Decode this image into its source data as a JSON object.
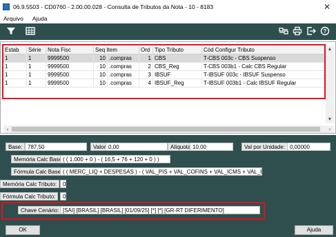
{
  "window": {
    "title": "06.9.5503 - CD0760 - 2.00.00.028 - Consulta de Tributos da Nota - 10 - 8183",
    "close": "✕"
  },
  "menu": {
    "items": [
      "Arquivo",
      "Ajuda"
    ]
  },
  "toolbar": {
    "filter_icon": "filter-icon",
    "table_icon": "table-icon",
    "right_icons": [
      "settings-icon",
      "print-icon",
      "exit-icon",
      "help-icon"
    ]
  },
  "grid": {
    "columns": [
      "Estab",
      "Série",
      "Nota Fisc",
      "Seq Item",
      "Ord",
      "Tipo Tributo",
      "Cód Configur Tributo"
    ],
    "rows": [
      {
        "estab": "1",
        "serie": "1",
        "nota": "9999500",
        "seq": "10",
        "item": ".compras",
        "ord": "1",
        "tipo": "CBS",
        "cod": "T-CBS 003c - CBS Suspenso"
      },
      {
        "estab": "1",
        "serie": "1",
        "nota": "9999500",
        "seq": "10",
        "item": ".compras",
        "ord": "2",
        "tipo": "CBS_Reg",
        "cod": "T-CBS 003b1 - Calc CBS Regular"
      },
      {
        "estab": "1",
        "serie": "1",
        "nota": "9999500",
        "seq": "10",
        "item": ".compras",
        "ord": "3",
        "tipo": "IBSUF",
        "cod": "T-IBSUF 003c - IBSUF Suspenso"
      },
      {
        "estab": "1",
        "serie": "1",
        "nota": "9999500",
        "seq": "10",
        "item": ".compras",
        "ord": "4",
        "tipo": "IBSUF_Reg",
        "cod": "T-IBSUF 003b1 - Calc IBSUF Regular"
      }
    ]
  },
  "details": {
    "base_label": "Base:",
    "base_value": "787,50",
    "valor_label": "Valor:",
    "valor_value": "0,00",
    "aliquota_label": "Alíquota:",
    "aliquota_value": "10,00",
    "valor_unidade_label": "Val por Unidade:",
    "valor_unidade_value": "0,00000",
    "memoria_base_label": "Memória Calc Base:",
    "memoria_base_value": "( ( 1.000 + 0 ) - ( 16,5 + 76 + 120 + 0 ) )",
    "formula_base_label": "Fórmula Calc Base:",
    "formula_base_value": "( ( MERC_LIQ + DESPESAS ) - ( VAL_PIS + VAL_COFINS + VAL_ICMS + VAL_ISS ) )",
    "memoria_tributo_label": "Memória Calc Tributo:",
    "memoria_tributo_value": "0",
    "formula_tributo_label": "Fórmula Calc Tributo:",
    "formula_tributo_value": "0",
    "chave_label": "Chave Cenário:",
    "chave_value": "[SAI] [BRASIL] [BRASIL] [01/09/25] [*] [*] [GR-RT DIFERIMENTO]"
  },
  "buttons": {
    "ok": "OK",
    "ajuda": "Ajuda"
  },
  "colors": {
    "toolbar_bg": "#2f4f4f",
    "highlight": "#e3101f"
  }
}
